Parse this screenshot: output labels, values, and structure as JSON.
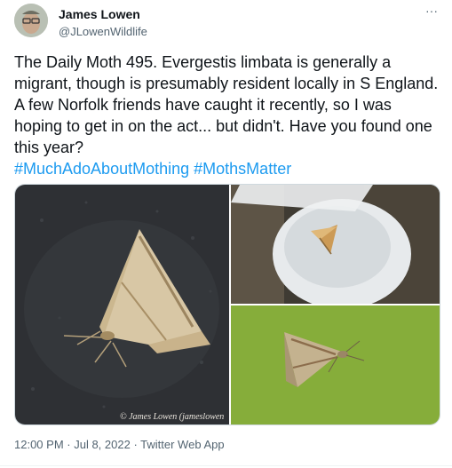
{
  "author": {
    "display_name": "James Lowen",
    "handle": "@JLowenWildlife"
  },
  "menu": {
    "more_label": "···"
  },
  "tweet": {
    "text": "The Daily Moth 495. Evergestis limbata is generally a migrant, though is presumably resident locally in S England. A few Norfolk friends have caught it recently, so I was hoping to get in on the act... but didn't. Have you found one this year?",
    "hashtags": [
      "#MuchAdoAboutMothing",
      "#MothsMatter"
    ]
  },
  "media": {
    "watermark": "© James Lowen (jameslowen"
  },
  "meta": {
    "time": "12:00 PM",
    "separator": " · ",
    "date": "Jul 8, 2022",
    "source": "Twitter Web App"
  },
  "colors": {
    "text": "#0f1419",
    "secondary": "#536471",
    "link": "#1d9bf0",
    "border": "#cfd9de"
  }
}
